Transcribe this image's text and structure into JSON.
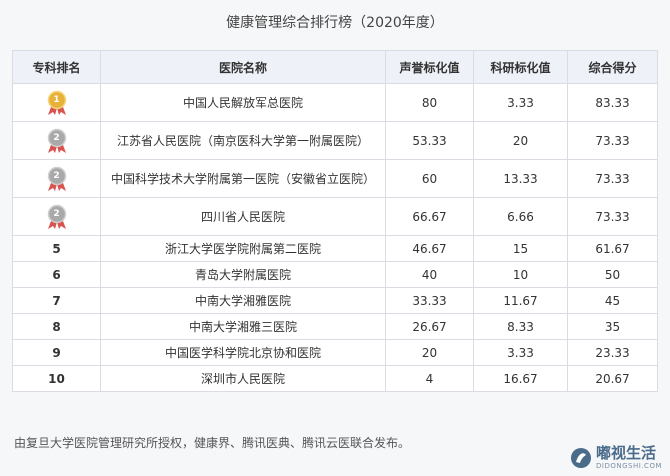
{
  "title": "健康管理综合排行榜（2020年度）",
  "headers": [
    "专科排名",
    "医院名称",
    "声誉标化值",
    "科研标化值",
    "综合得分"
  ],
  "rows": [
    {
      "rank": "1",
      "name": "中国人民解放军总医院",
      "reputation": "80",
      "research": "3.33",
      "total": "83.33"
    },
    {
      "rank": "2",
      "name": "江苏省人民医院（南京医科大学第一附属医院）",
      "reputation": "53.33",
      "research": "20",
      "total": "73.33"
    },
    {
      "rank": "2",
      "name": "中国科学技术大学附属第一医院（安徽省立医院）",
      "reputation": "60",
      "research": "13.33",
      "total": "73.33"
    },
    {
      "rank": "2",
      "name": "四川省人民医院",
      "reputation": "66.67",
      "research": "6.66",
      "total": "73.33"
    },
    {
      "rank": "5",
      "name": "浙江大学医学院附属第二医院",
      "reputation": "46.67",
      "research": "15",
      "total": "61.67"
    },
    {
      "rank": "6",
      "name": "青岛大学附属医院",
      "reputation": "40",
      "research": "10",
      "total": "50"
    },
    {
      "rank": "7",
      "name": "中南大学湘雅医院",
      "reputation": "33.33",
      "research": "11.67",
      "total": "45"
    },
    {
      "rank": "8",
      "name": "中南大学湘雅三医院",
      "reputation": "26.67",
      "research": "8.33",
      "total": "35"
    },
    {
      "rank": "9",
      "name": "中国医学科学院北京协和医院",
      "reputation": "20",
      "research": "3.33",
      "total": "23.33"
    },
    {
      "rank": "10",
      "name": "深圳市人民医院",
      "reputation": "4",
      "research": "16.67",
      "total": "20.67"
    }
  ],
  "footer": "由复旦大学医院管理研究所授权，健康界、腾讯医典、腾讯云医联合发布。",
  "watermark": {
    "main": "嘟视生活",
    "sub": "DIDONGSHI.COM"
  },
  "colors": {
    "gold": "#e8b23a",
    "silver": "#a9a9a9",
    "ribbon": "#d9534f",
    "header_bg": "#eef1f7"
  }
}
